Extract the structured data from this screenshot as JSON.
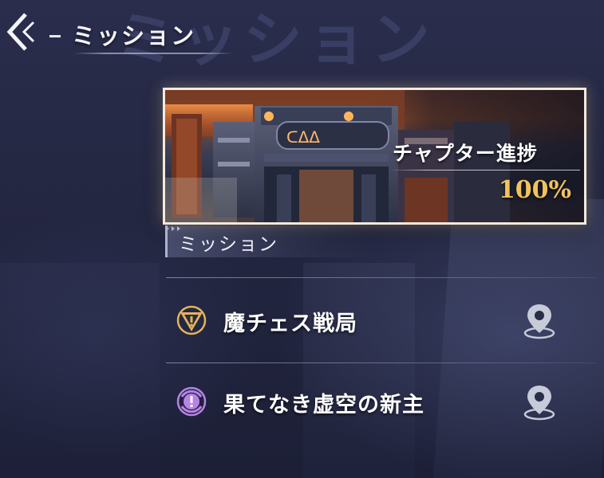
{
  "header": {
    "title": "ミッション",
    "watermark": "ミッション"
  },
  "chapter": {
    "title": "チャプター進捗",
    "progress": "100%",
    "progress_value": 1.0,
    "sign_text": "ᑕᐃᐃ"
  },
  "section": {
    "label": "ミッション"
  },
  "missions": [
    {
      "name": "魔チェス戦局",
      "icon": "triangle-warning-icon",
      "icon_color": "#e3b45a",
      "action_icon": "map-pin-icon"
    },
    {
      "name": "果てなき虚空の新主",
      "icon": "circle-exclamation-icon",
      "icon_color": "#b783e6",
      "action_icon": "map-pin-icon"
    }
  ],
  "colors": {
    "accent_gold": "#f2c35c",
    "accent_purple": "#b783e6",
    "card_border": "#f3eadb"
  }
}
